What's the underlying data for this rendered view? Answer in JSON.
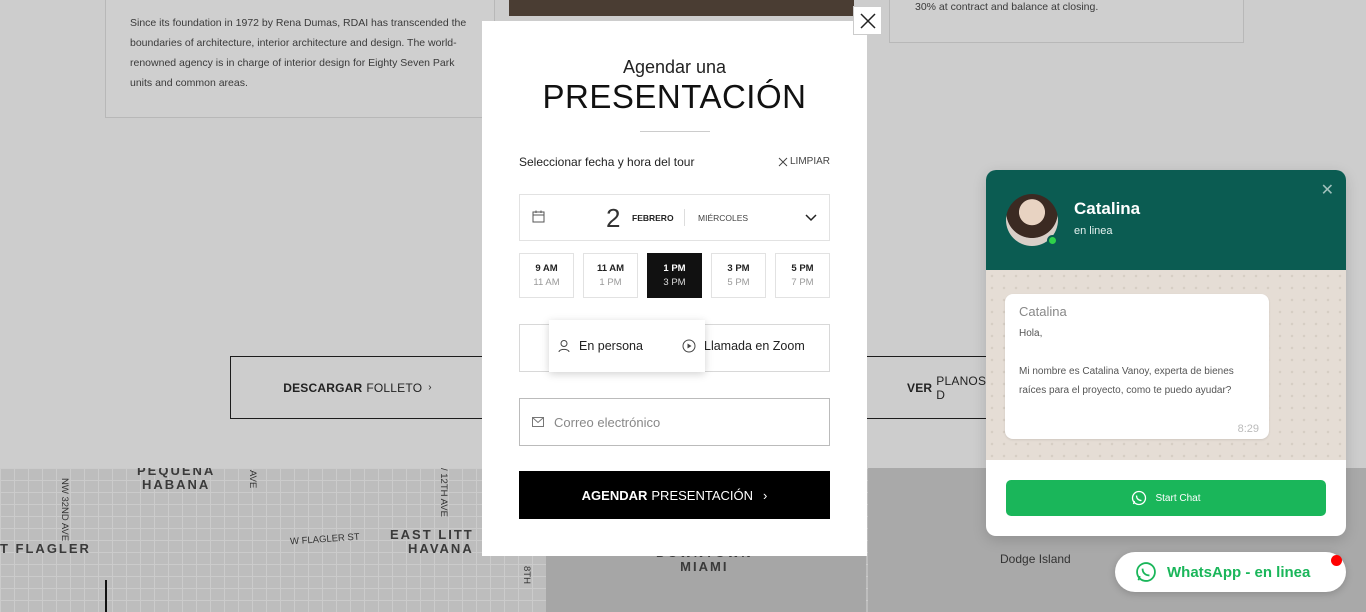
{
  "background": {
    "about_text": "Since its foundation in 1972 by Rena Dumas, RDAI has transcended the boundaries of architecture, interior architecture and design. The world-renowned agency is in charge of interior design for Eighty Seven Park units and common areas.",
    "payment_text": "30% at contract and balance at closing.",
    "download_button": {
      "bold": "DESCARGAR",
      "rest": "FOLLETO"
    },
    "plans_button": {
      "bold": "VER",
      "rest": "PLANOS D"
    },
    "map_labels": {
      "pequena_habana": "PEQUENA\nHABANA",
      "east_little_havana": "EAST LITT\nHAVANA",
      "flagler": "T FLAGLER",
      "w_flagler": "W Flagler St",
      "nw32": "NW 32nd Ave",
      "ave": "Ave",
      "twelfth": "/ 12th Ave",
      "eighth": "8th",
      "downtown": "DOWNTOWN\nMIAMI",
      "dodge": "Dodge Island"
    }
  },
  "modal": {
    "title_top": "Agendar una",
    "title_main": "PRESENTACIÓN",
    "select_label": "Seleccionar fecha y hora del tour",
    "clear_label": "LIMPIAR",
    "date": {
      "day": "2",
      "month": "FEBRERO",
      "weekday": "MIÉRCOLES"
    },
    "slots": [
      {
        "start": "9 AM",
        "end": "11 AM",
        "active": false
      },
      {
        "start": "11 AM",
        "end": "1 PM",
        "active": false
      },
      {
        "start": "1 PM",
        "end": "3 PM",
        "active": true
      },
      {
        "start": "3 PM",
        "end": "5 PM",
        "active": false
      },
      {
        "start": "5 PM",
        "end": "7 PM",
        "active": false
      }
    ],
    "mode_person": "En persona",
    "mode_zoom": "Llamada en Zoom",
    "email_placeholder": "Correo electrónico",
    "submit": {
      "bold": "AGENDAR",
      "rest": "PRESENTACIÓN"
    }
  },
  "whatsapp": {
    "name": "Catalina",
    "status": "en linea",
    "bubble_from": "Catalina",
    "bubble_message": "Hola,\n\nMi nombre es Catalina Vanoy, experta de bienes raíces para el proyecto, como te puedo ayudar?",
    "bubble_time": "8:29",
    "start_chat": "Start Chat",
    "pill_label": "WhatsApp - en linea",
    "brand_color": "#1ab65a",
    "header_color": "#0b5c52"
  }
}
